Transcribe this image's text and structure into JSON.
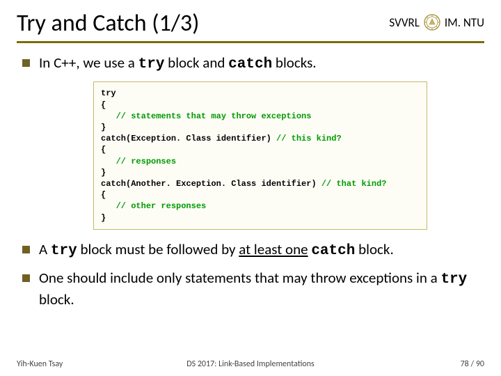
{
  "header": {
    "title": "Try and Catch (1/3)",
    "affil_left": "SVVRL",
    "affil_right": "IM. NTU"
  },
  "bullets": {
    "b1_pre": "In C++, we use a ",
    "b1_kw1": "try",
    "b1_mid": " block and ",
    "b1_kw2": "catch",
    "b1_post": " blocks.",
    "b2_pre": "A ",
    "b2_kw1": "try",
    "b2_mid1": " block must be followed by ",
    "b2_u": "at least one",
    "b2_mid2": " ",
    "b2_kw2": "catch",
    "b2_post": " block.",
    "b3_pre": "One should include only statements that may throw exceptions in a ",
    "b3_kw": "try",
    "b3_post": " block."
  },
  "code": {
    "l01": "try",
    "l02": "{",
    "l03a": "   ",
    "l03b": "// statements that may throw exceptions",
    "l04": "}",
    "l05a": "catch(Exception. Class identifier) ",
    "l05b": "// this kind?",
    "l06": "{",
    "l07a": "   ",
    "l07b": "// responses",
    "l08": "}",
    "l09a": "catch(Another. Exception. Class identifier) ",
    "l09b": "// that kind?",
    "l10": "{",
    "l11a": "   ",
    "l11b": "// other responses",
    "l12": "}"
  },
  "footer": {
    "left": "Yih-Kuen Tsay",
    "center": "DS 2017: Link-Based Implementations",
    "page_cur": "78",
    "page_sep": " / ",
    "page_tot": "90"
  }
}
